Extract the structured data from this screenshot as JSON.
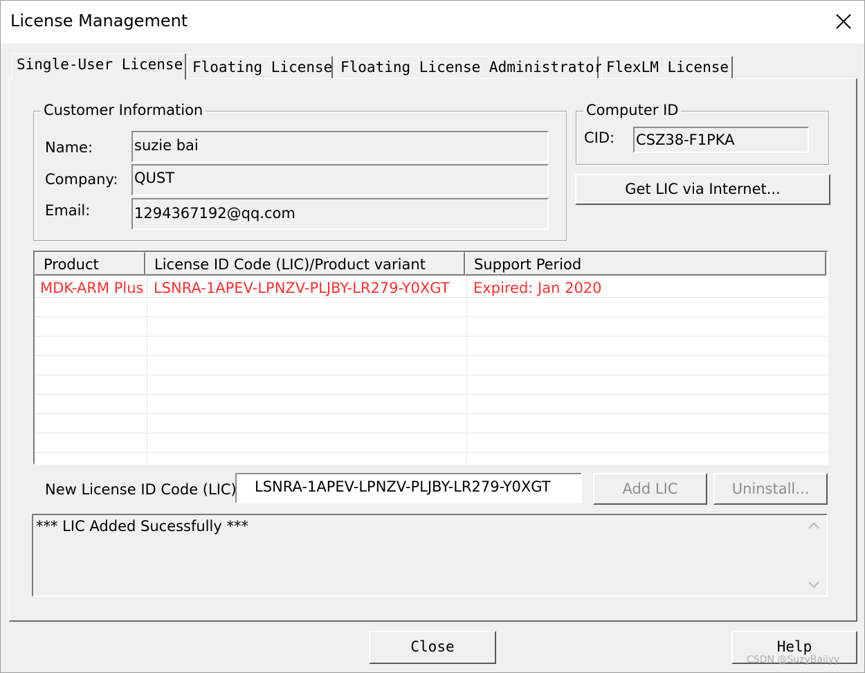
{
  "window": {
    "title": "License Management",
    "close_icon": "close-icon"
  },
  "tabs": [
    {
      "label": "Single-User License",
      "active": true
    },
    {
      "label": "Floating License",
      "active": false
    },
    {
      "label": "Floating License Administrator",
      "active": false
    },
    {
      "label": "FlexLM License",
      "active": false
    }
  ],
  "customer": {
    "legend": "Customer Information",
    "name_label": "Name:",
    "name_value": "suzie bai",
    "company_label": "Company:",
    "company_value": "QUST",
    "email_label": "Email:",
    "email_value": "1294367192@qq.com"
  },
  "computer": {
    "legend": "Computer ID",
    "cid_label": "CID:",
    "cid_value": "CSZ38-F1PKA",
    "get_lic_label": "Get LIC via Internet..."
  },
  "table": {
    "columns": [
      "Product",
      "License ID Code (LIC)/Product variant",
      "Support Period"
    ],
    "rows": [
      [
        "MDK-ARM Plus",
        "LSNRA-1APEV-LPNZV-PLJBY-LR279-Y0XGT",
        "Expired: Jan 2020"
      ]
    ],
    "row_color": "#ff3030"
  },
  "new_lic": {
    "label": "New License ID Code (LIC):",
    "value": "LSNRA-1APEV-LPNZV-PLJBY-LR279-Y0XGT",
    "add_label": "Add LIC",
    "uninstall_label": "Uninstall..."
  },
  "status": {
    "message": "*** LIC Added Sucessfully ***"
  },
  "footer": {
    "close_label": "Close",
    "help_label": "Help"
  },
  "watermark": "CSDN @SuzyBaiiyy"
}
